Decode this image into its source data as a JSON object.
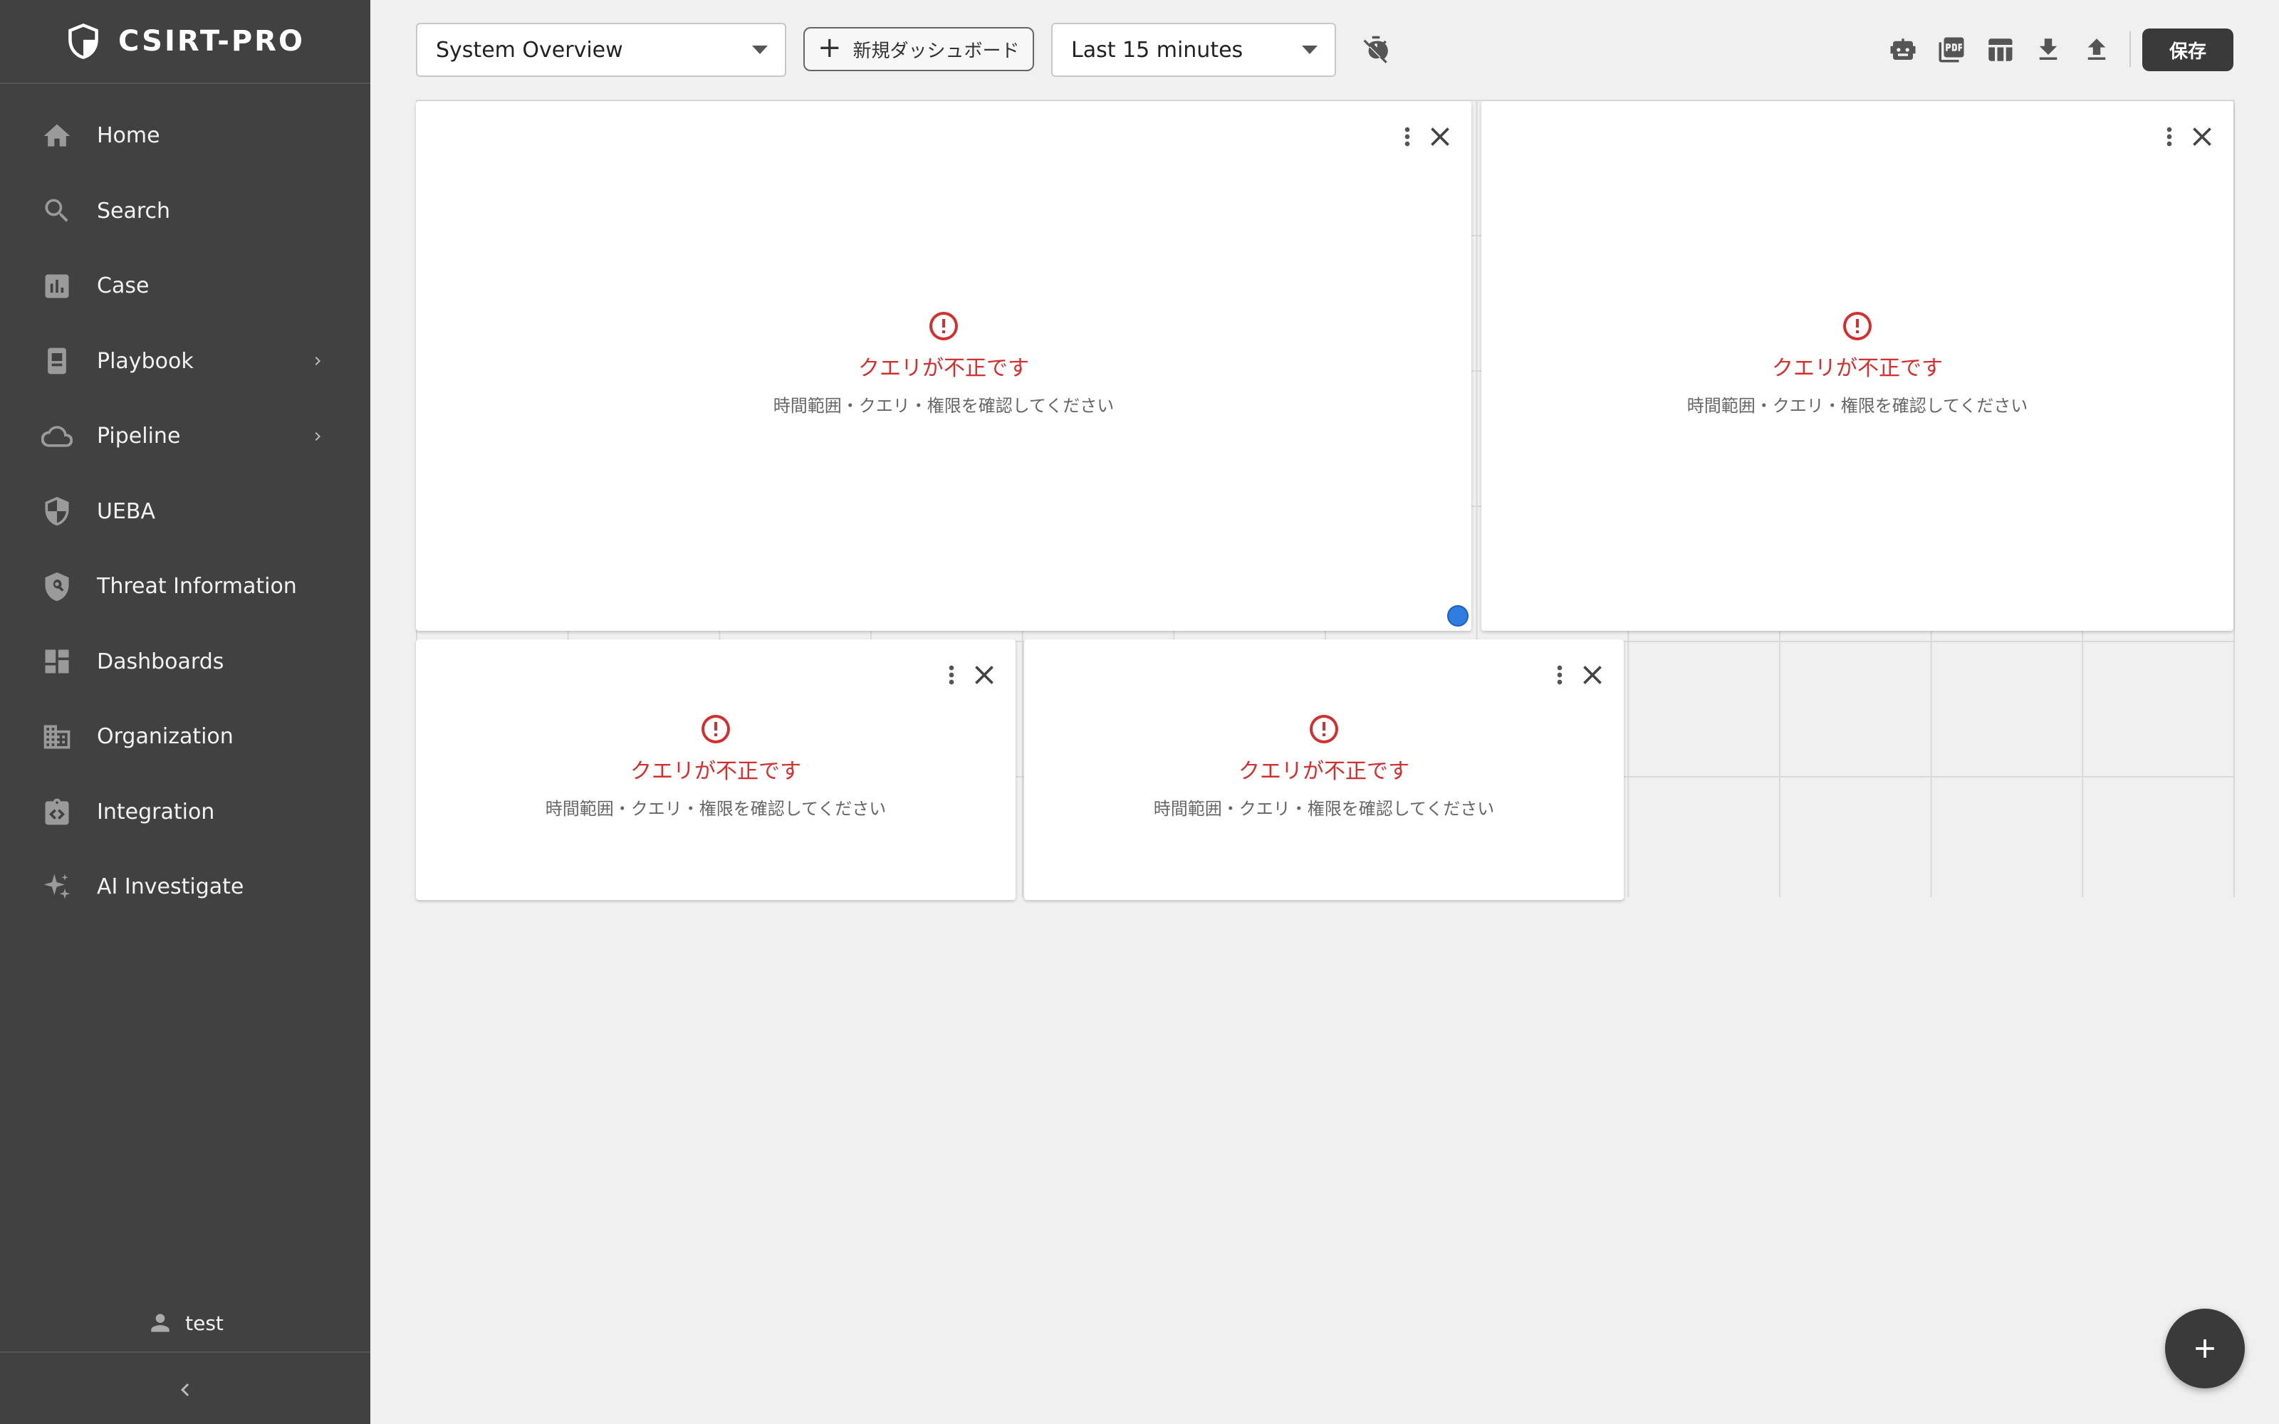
{
  "app": {
    "brand": "CSIRT-PRO"
  },
  "sidebar": {
    "items": [
      {
        "label": "Home",
        "icon": "home-icon",
        "has_submenu": false
      },
      {
        "label": "Search",
        "icon": "search-icon",
        "has_submenu": false
      },
      {
        "label": "Case",
        "icon": "bar-chart-icon",
        "has_submenu": false
      },
      {
        "label": "Playbook",
        "icon": "playbook-icon",
        "has_submenu": true
      },
      {
        "label": "Pipeline",
        "icon": "cloud-icon",
        "has_submenu": true
      },
      {
        "label": "UEBA",
        "icon": "shield-icon",
        "has_submenu": false
      },
      {
        "label": "Threat Information",
        "icon": "shield-search-icon",
        "has_submenu": false
      },
      {
        "label": "Dashboards",
        "icon": "dashboard-icon",
        "has_submenu": false
      },
      {
        "label": "Organization",
        "icon": "building-icon",
        "has_submenu": false
      },
      {
        "label": "Integration",
        "icon": "integration-icon",
        "has_submenu": false
      },
      {
        "label": "AI Investigate",
        "icon": "sparkle-icon",
        "has_submenu": false
      }
    ],
    "user": {
      "name": "test"
    }
  },
  "toolbar": {
    "dashboard_select": {
      "value": "System Overview"
    },
    "new_dashboard_label": "新規ダッシュボード",
    "time_range_select": {
      "value": "Last 15 minutes"
    },
    "icons": [
      "timer-off-icon",
      "robot-icon",
      "pdf-icon",
      "table-icon",
      "download-icon",
      "upload-icon"
    ],
    "save_label": "保存"
  },
  "panels": [
    {
      "error_title": "クエリが不正です",
      "error_message": "時間範囲・クエリ・権限を確認してください"
    },
    {
      "error_title": "クエリが不正です",
      "error_message": "時間範囲・クエリ・権限を確認してください"
    },
    {
      "error_title": "クエリが不正です",
      "error_message": "時間範囲・クエリ・権限を確認してください"
    },
    {
      "error_title": "クエリが不正です",
      "error_message": "時間範囲・クエリ・権限を確認してください"
    }
  ],
  "colors": {
    "sidebar_bg": "#424141",
    "page_bg": "#f0f0f0",
    "error": "#d32f2f",
    "primary_button": "#3a3a3a",
    "resize_handle": "#2f7de1"
  }
}
